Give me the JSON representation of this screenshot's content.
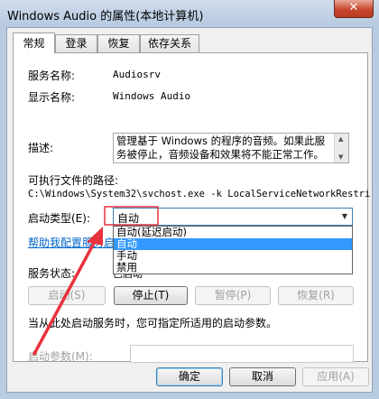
{
  "window": {
    "title": "Windows Audio 的属性(本地计算机)",
    "close_glyph": "✕"
  },
  "tabs": [
    {
      "label": "常规"
    },
    {
      "label": "登录"
    },
    {
      "label": "恢复"
    },
    {
      "label": "依存关系"
    }
  ],
  "general": {
    "service_name_label": "服务名称:",
    "service_name_value": "Audiosrv",
    "display_name_label": "显示名称:",
    "display_name_value": "Windows Audio",
    "description_label": "描述:",
    "description_value": "管理基于 Windows 的程序的音频。如果此服务被停止，音频设备和效果将不能正常工作。如",
    "exe_path_label": "可执行文件的路径:",
    "exe_path_value": "C:\\Windows\\System32\\svchost.exe -k LocalServiceNetworkRestri",
    "startup_type_label": "启动类型(E):",
    "startup_type_value": "自动",
    "startup_options": [
      "自动(延迟启动)",
      "自动",
      "手动",
      "禁用"
    ],
    "help_link": "帮助我配置服务启",
    "service_status_label": "服务状态:",
    "service_status_value": "已启动",
    "buttons": {
      "start": "启动(S)",
      "stop": "停止(T)",
      "pause": "暂停(P)",
      "resume": "恢复(R)"
    },
    "hint": "当从此处启动服务时，您可指定所适用的启动参数。",
    "start_params_label": "启动参数(M):",
    "start_params_value": ""
  },
  "footer": {
    "ok": "确定",
    "cancel": "取消",
    "apply": "应用(A)"
  },
  "colors": {
    "annotation": "#e8323c",
    "selection": "#3399ff",
    "link": "#0066cc"
  }
}
